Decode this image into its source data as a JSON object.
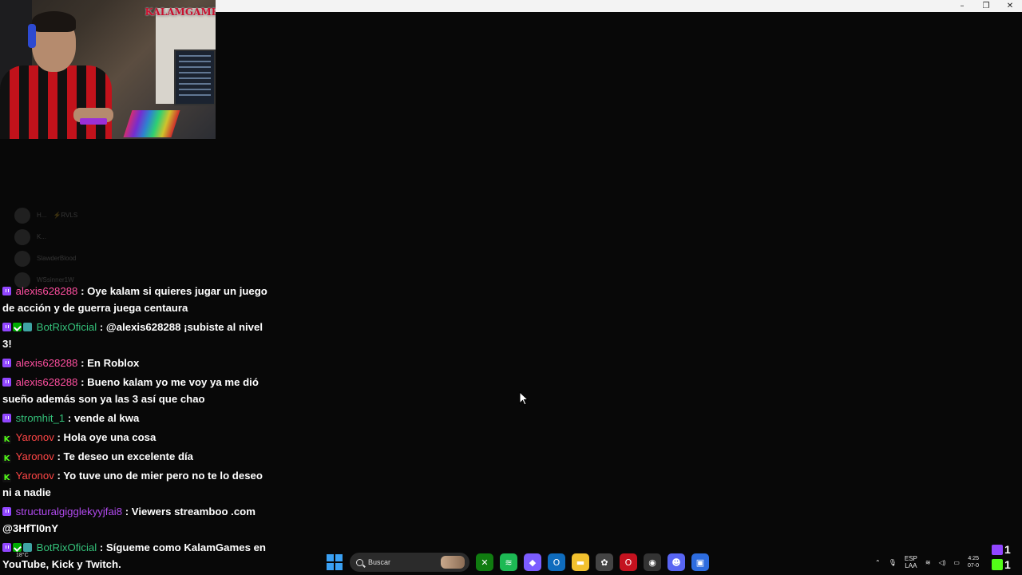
{
  "window": {
    "controls": {
      "minimize": "–",
      "maximize": "❐",
      "close": "✕"
    }
  },
  "webcam": {
    "logo_text": "KALAMGAMES"
  },
  "faded_chat": [
    {
      "name": "H...",
      "extra": "⚡RVLS"
    },
    {
      "name": "K..."
    },
    {
      "name": "SlawderBlood"
    },
    {
      "name": "WSsinner1W"
    }
  ],
  "chat": [
    {
      "platform": "twitch",
      "badges": [],
      "user": "alexis628288",
      "color": "pink",
      "text": ": Oye kalam si quieres jugar un juego de acción y de guerra juega centaura"
    },
    {
      "platform": "twitch",
      "badges": [
        "mod",
        "bot"
      ],
      "user": "BotRixOficial",
      "color": "green",
      "text": ": @alexis628288 ¡subiste al nivel 3!"
    },
    {
      "platform": "twitch",
      "badges": [],
      "user": "alexis628288",
      "color": "pink",
      "text": ": En Roblox"
    },
    {
      "platform": "twitch",
      "badges": [],
      "user": "alexis628288",
      "color": "pink",
      "text": ": Bueno kalam yo me voy ya me dió sueño además son ya las 3 así que chao"
    },
    {
      "platform": "twitch",
      "badges": [],
      "user": "stromhit_1",
      "color": "green",
      "text": ": vende al kwa"
    },
    {
      "platform": "kick",
      "badges": [],
      "user": "Yaronov",
      "color": "red",
      "text": ": Hola oye una cosa"
    },
    {
      "platform": "kick",
      "badges": [],
      "user": "Yaronov",
      "color": "red",
      "text": ": Te deseo un excelente día"
    },
    {
      "platform": "kick",
      "badges": [],
      "user": "Yaronov",
      "color": "red",
      "text": ": Yo tuve uno de mier pero no te lo deseo ni a nadie"
    },
    {
      "platform": "twitch",
      "badges": [],
      "user": "structuralgigglekyyjfai8",
      "color": "purple",
      "text": ": Viewers streamboo .com @3HfTI0nY"
    },
    {
      "platform": "twitch",
      "badges": [
        "mod",
        "bot"
      ],
      "user": "BotRixOficial",
      "color": "green",
      "text": ": Sígueme como KalamGames en YouTube, Kick y Twitch."
    }
  ],
  "taskbar": {
    "weather": "18°C",
    "search_placeholder": "Buscar",
    "apps": [
      {
        "name": "xbox-icon",
        "glyph": "✕",
        "color": "#107c10"
      },
      {
        "name": "spotify-icon",
        "glyph": "≋",
        "color": "#1db954"
      },
      {
        "name": "copilot-icon",
        "glyph": "◆",
        "color": "#7b5cff"
      },
      {
        "name": "outlook-icon",
        "glyph": "O",
        "color": "#0f6cbd"
      },
      {
        "name": "file-explorer-icon",
        "glyph": "▬",
        "color": "#f2c12e"
      },
      {
        "name": "app-icon",
        "glyph": "✿",
        "color": "#444"
      },
      {
        "name": "opera-icon",
        "glyph": "O",
        "color": "#c4121f"
      },
      {
        "name": "obs-icon",
        "glyph": "◉",
        "color": "#333"
      },
      {
        "name": "discord-icon",
        "glyph": "☻",
        "color": "#5865f2"
      },
      {
        "name": "active-app-icon",
        "glyph": "▣",
        "color": "#2d6cdf"
      }
    ],
    "lang": "ESP",
    "lang_sub": "LAA",
    "clock_time": "4:25",
    "clock_date": "07-0",
    "twitch_count": "1",
    "kick_count": "1"
  }
}
